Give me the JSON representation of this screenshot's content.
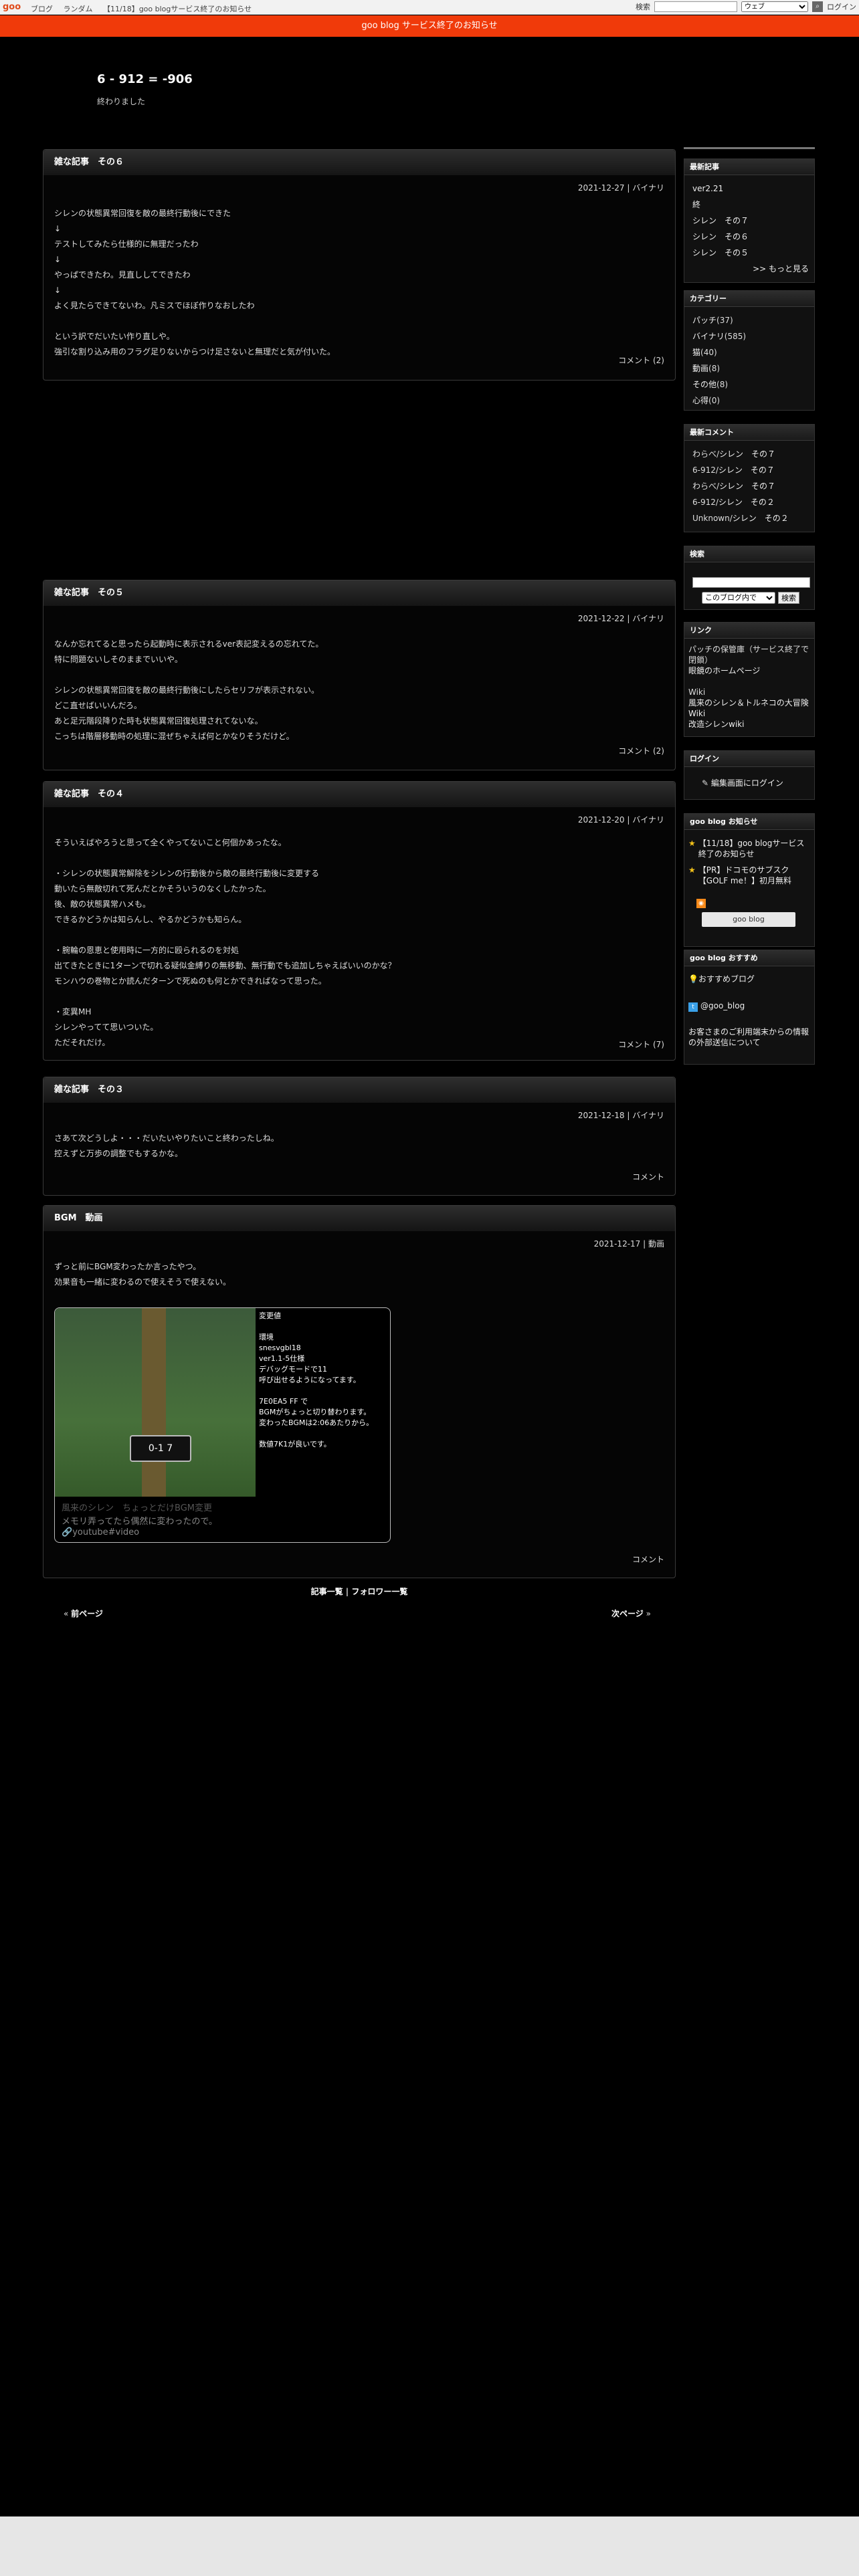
{
  "topbar": {
    "logo": "goo",
    "links": [
      "ブログ",
      "ランダム",
      "【11/18】goo blogサービス終了のお知らせ"
    ],
    "search_label": "検索",
    "search_scope": "ウェブ",
    "login": "ログイン"
  },
  "notice": "goo blog サービス終了のお知らせ",
  "blog": {
    "title": "6 - 912 = -906",
    "description": "終わりました"
  },
  "posts": [
    {
      "title": "雑な記事　その６",
      "date": "2021-12-27",
      "category": "バイナリ",
      "body": "シレンの状態異常回復を敵の最終行動後にできた\n↓\nテストしてみたら仕様的に無理だったわ\n↓\nやっぱできたわ。見直ししてできたわ\n↓\nよく見たらできてないわ。凡ミスでほぼ作りなおしたわ\n\nという訳でだいたい作り直しや。\n強引な割り込み用のフラグ足りないからつけ足さないと無理だと気が付いた。",
      "footer": "コメント (2)"
    },
    {
      "title": "雑な記事　その５",
      "date": "2021-12-22",
      "category": "バイナリ",
      "body": "なんか忘れてると思ったら起動時に表示されるver表記変えるの忘れてた。\n特に問題ないしそのままでいいや。\n\nシレンの状態異常回復を敵の最終行動後にしたらセリフが表示されない。\nどこ直せばいいんだろ。\nあと足元階段降りた時も状態異常回復処理されてないな。\nこっちは階層移動時の処理に混ぜちゃえば何とかなりそうだけど。",
      "footer": "コメント (2)"
    },
    {
      "title": "雑な記事　その４",
      "date": "2021-12-20",
      "category": "バイナリ",
      "body": "そういえばやろうと思って全くやってないこと何個かあったな。\n\n・シレンの状態異常解除をシレンの行動後から敵の最終行動後に変更する\n動いたら無敵切れて死んだとかそういうのなくしたかった。\n後、敵の状態異常ハメも。\nできるかどうかは知らんし、やるかどうかも知らん。\n\n・腕輪の恩恵と使用時に一方的に殴られるのを対処\n出てきたときに1ターンで切れる疑似金縛りの無移動、無行動でも追加しちゃえばいいのかな？\nモンハウの巻物とか読んだターンで死ぬのも何とかできればなって思った。\n\n・変異MH\nシレンやってて思いついた。\nただそれだけ。",
      "footer": "コメント (7)"
    },
    {
      "title": "雑な記事　その３",
      "date": "2021-12-18",
      "category": "バイナリ",
      "body": "さあて次どうしよ・・・だいたいやりたいこと終わったしね。\n控えずと万歩の調整でもするかな。",
      "footer": "コメント"
    },
    {
      "title": "BGM　動画",
      "date": "2021-12-17",
      "category": "動画",
      "body": "ずっと前にBGM変わったか言ったやつ。\n効果音も一緒に変わるので使えそうで使えない。",
      "footer": "コメント",
      "video": {
        "notes": "変更値\n\n環境\nsnesvgbl18\nver1.1-5仕様\nデバッグモードで11\n呼び出せるようになってます。\n\n7E0EA5 FF で\nBGMがちょっと切り替わります。\n変わったBGMは2:06あたりから。\n\n数値7K1が良いです。",
        "hud": "0-1  7",
        "title": "風来のシレン　ちょっとだけBGM変更",
        "description": "メモリ弄ってたら偶然に変わったので。",
        "link": "youtube#video"
      }
    }
  ],
  "pager": {
    "list_link": "記事一覧",
    "separator": "|",
    "follow_link": "フォロワー一覧",
    "prev": "前ページ",
    "next": "次ページ"
  },
  "sidebar": {
    "recent": {
      "title": "最新記事",
      "items": [
        "ver2.21",
        "終",
        "シレン　その７",
        "シレン　その６",
        "シレン　その５"
      ],
      "more": ">> もっと見る"
    },
    "categories": {
      "title": "カテゴリー",
      "items": [
        {
          "name": "パッチ",
          "count": "(37)"
        },
        {
          "name": "バイナリ",
          "count": "(585)"
        },
        {
          "name": "猫",
          "count": "(40)"
        },
        {
          "name": "動画",
          "count": "(8)"
        },
        {
          "name": "その他",
          "count": "(8)"
        },
        {
          "name": "心得",
          "count": "(0)"
        }
      ]
    },
    "comments": {
      "title": "最新コメント",
      "items": [
        {
          "user": "わらべ/",
          "post": "シレン　その７"
        },
        {
          "user": "6-912/",
          "post": "シレン　その７"
        },
        {
          "user": "わらべ/",
          "post": "シレン　その７"
        },
        {
          "user": "6-912/",
          "post": "シレン　その２"
        },
        {
          "user": "Unknown/",
          "post": "シレン　その２"
        }
      ]
    },
    "search": {
      "title": "検索",
      "scope": "このブログ内で",
      "button": "検索"
    },
    "links": {
      "title": "リンク",
      "text1": "パッチの保管庫（サービス終了で閉鎖）",
      "link1": "眼鏡のホームページ",
      "text2": "Wiki",
      "link2": "風来のシレン＆トルネコの大冒険 Wiki",
      "link3": "改造シレンwiki"
    },
    "login": {
      "title": "ログイン",
      "link": "編集画面にログイン"
    },
    "notices": {
      "title": "goo blog お知らせ",
      "items": [
        "【11/18】goo blogサービス終了のお知らせ",
        "【PR】ドコモのサブスク【GOLF me！】初月無料"
      ],
      "badge": "goo blog"
    },
    "recommend": {
      "title": "goo blog おすすめ",
      "link": "おすすめブログ",
      "twitter": "@goo_blog",
      "info": "お客さまのご利用端末からの情報の外部送信について"
    }
  }
}
